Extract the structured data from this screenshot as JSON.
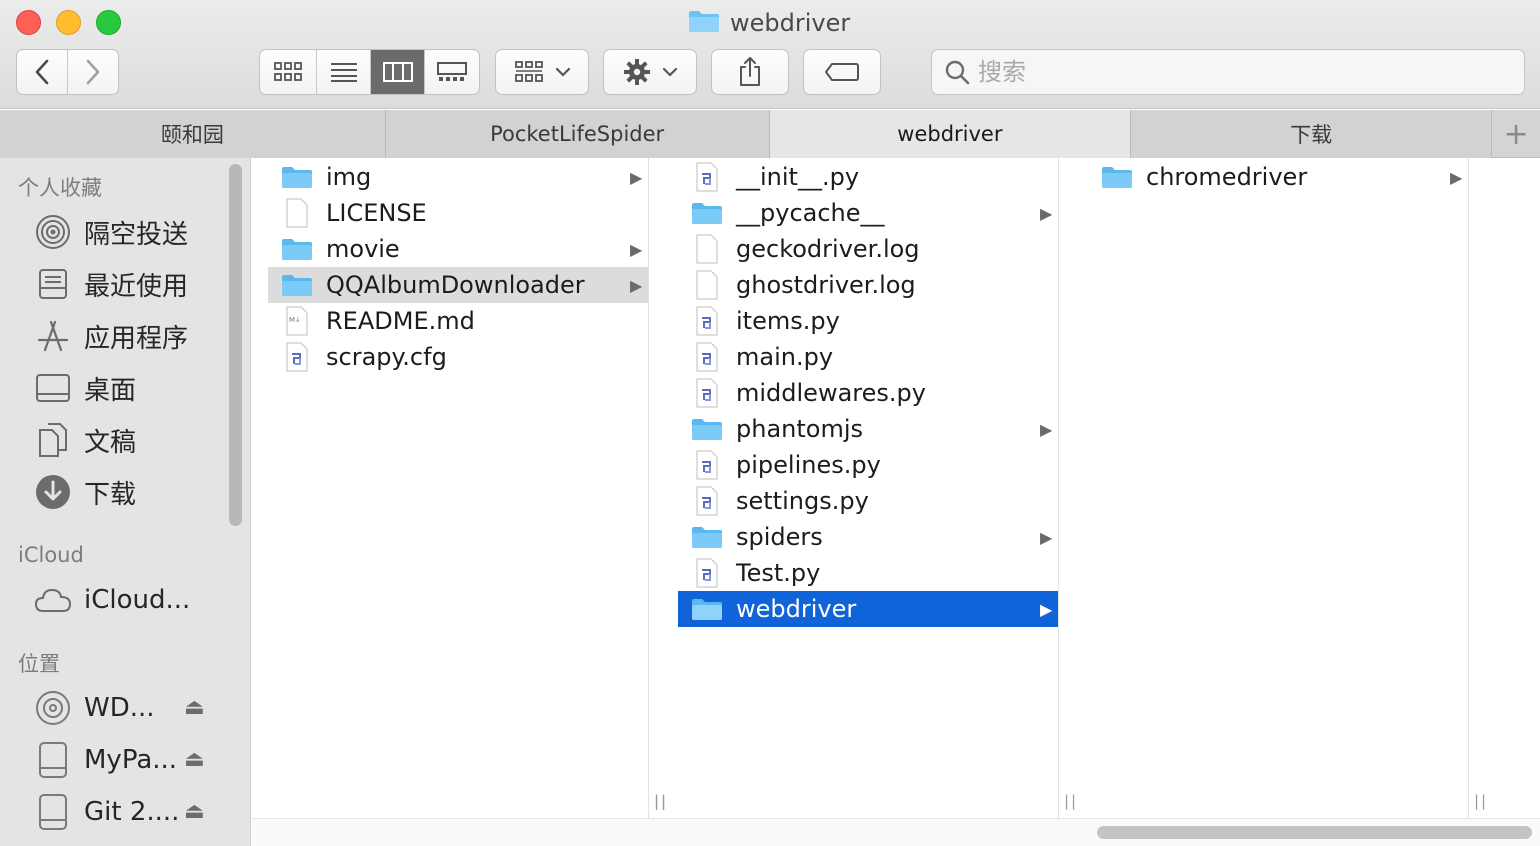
{
  "window": {
    "title": "webdriver"
  },
  "search": {
    "placeholder": "搜索",
    "value": ""
  },
  "tabs": [
    {
      "label": "颐和园"
    },
    {
      "label": "PocketLifeSpider"
    },
    {
      "label": "webdriver"
    },
    {
      "label": "下载"
    }
  ],
  "tab_add_symbol": "+",
  "sidebar": {
    "favorites_title": "个人收藏",
    "favorites": [
      {
        "label": "隔空投送",
        "icon": "airdrop-icon"
      },
      {
        "label": "最近使用",
        "icon": "recents-icon"
      },
      {
        "label": "应用程序",
        "icon": "applications-icon"
      },
      {
        "label": "桌面",
        "icon": "desktop-icon"
      },
      {
        "label": "文稿",
        "icon": "documents-icon"
      },
      {
        "label": "下载",
        "icon": "downloads-icon"
      }
    ],
    "icloud_title": "iCloud",
    "icloud_items": [
      {
        "label": "iCloud...",
        "icon": "cloud-icon"
      }
    ],
    "locations_title": "位置",
    "locations": [
      {
        "label": "WD...",
        "icon": "disk-icon",
        "eject": "⏏"
      },
      {
        "label": "MyPa...",
        "icon": "drive-icon",
        "eject": "⏏"
      },
      {
        "label": "Git 2....",
        "icon": "drive-icon",
        "eject": "⏏"
      }
    ]
  },
  "columns": [
    {
      "items": [
        {
          "name": "img",
          "type": "folder",
          "has_children": true
        },
        {
          "name": "LICENSE",
          "type": "file"
        },
        {
          "name": "movie",
          "type": "folder",
          "has_children": true
        },
        {
          "name": "QQAlbumDownloader",
          "type": "folder",
          "has_children": true,
          "selected": "inactive"
        },
        {
          "name": "README.md",
          "type": "markdown"
        },
        {
          "name": "scrapy.cfg",
          "type": "python"
        }
      ]
    },
    {
      "items": [
        {
          "name": "__init__.py",
          "type": "python"
        },
        {
          "name": "__pycache__",
          "type": "folder",
          "has_children": true
        },
        {
          "name": "geckodriver.log",
          "type": "file"
        },
        {
          "name": "ghostdriver.log",
          "type": "file"
        },
        {
          "name": "items.py",
          "type": "python"
        },
        {
          "name": "main.py",
          "type": "python"
        },
        {
          "name": "middlewares.py",
          "type": "python"
        },
        {
          "name": "phantomjs",
          "type": "folder",
          "has_children": true
        },
        {
          "name": "pipelines.py",
          "type": "python"
        },
        {
          "name": "settings.py",
          "type": "python"
        },
        {
          "name": "spiders",
          "type": "folder",
          "has_children": true
        },
        {
          "name": "Test.py",
          "type": "python"
        },
        {
          "name": "webdriver",
          "type": "folder",
          "has_children": true,
          "selected": "active"
        }
      ]
    },
    {
      "items": [
        {
          "name": "chromedriver",
          "type": "folder",
          "has_children": true
        }
      ]
    }
  ],
  "colors": {
    "selection_active": "#1063d8",
    "selection_inactive": "#dcdcdc",
    "folder": "#6ac3f5",
    "traffic_red": "#fe5f57",
    "traffic_yellow": "#febc2e",
    "traffic_green": "#28c840"
  }
}
